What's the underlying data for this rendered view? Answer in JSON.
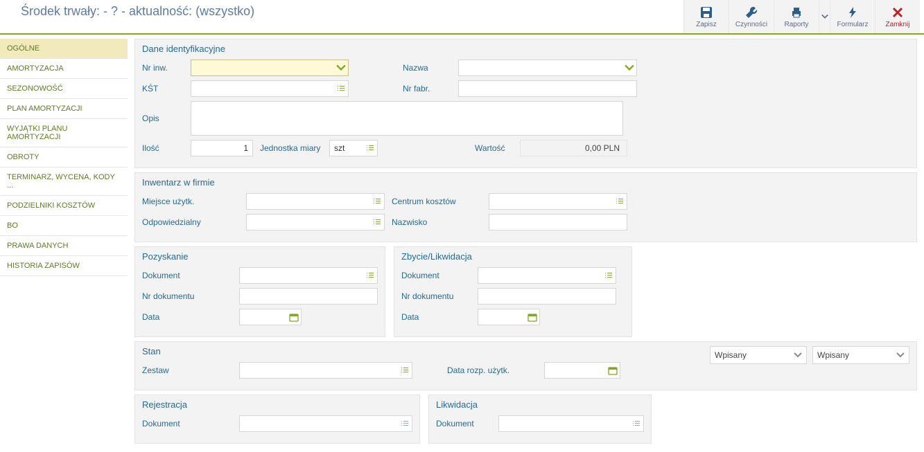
{
  "header": {
    "title": "Środek trwały: - ? - aktualność: (wszystko)",
    "toolbar": {
      "save": "Zapisz",
      "actions": "Czynności",
      "reports": "Raporty",
      "form": "Formularz",
      "close": "Zamknij"
    }
  },
  "sidebar": {
    "items": [
      {
        "label": "OGÓLNE",
        "active": true
      },
      {
        "label": "AMORTYZACJA"
      },
      {
        "label": "SEZONOWOŚĆ"
      },
      {
        "label": "PLAN AMORTYZACJI"
      },
      {
        "label": "WYJĄTKI PLANU AMORTYZACJI"
      },
      {
        "label": "OBROTY"
      },
      {
        "label": "TERMINARZ, WYCENA, KODY ..."
      },
      {
        "label": "PODZIELNIKI KOSZTÓW"
      },
      {
        "label": "BO"
      },
      {
        "label": "PRAWA DANYCH"
      },
      {
        "label": "HISTORIA ZAPISÓW"
      }
    ]
  },
  "sections": {
    "ident": {
      "title": "Dane identyfikacyjne",
      "nr_inw_label": "Nr inw.",
      "nr_inw_value": "",
      "nazwa_label": "Nazwa",
      "nazwa_value": "",
      "kst_label": "KŚT",
      "kst_value": "",
      "nr_fabr_label": "Nr fabr.",
      "nr_fabr_value": "",
      "opis_label": "Opis",
      "opis_value": "",
      "ilosc_label": "Ilość",
      "ilosc_value": "1",
      "jm_label": "Jednostka miary",
      "jm_value": "szt",
      "wartosc_label": "Wartość",
      "wartosc_value": "0,00 PLN"
    },
    "inwentarz": {
      "title": "Inwentarz w firmie",
      "miejsce_label": "Miejsce użytk.",
      "centrum_label": "Centrum kosztów",
      "odp_label": "Odpowiedzialny",
      "nazwisko_label": "Nazwisko"
    },
    "pozyskanie": {
      "title": "Pozyskanie",
      "dok_label": "Dokument",
      "nrdok_label": "Nr dokumentu",
      "data_label": "Data"
    },
    "zbycie": {
      "title": "Zbycie/Likwidacja",
      "dok_label": "Dokument",
      "nrdok_label": "Nr dokumentu",
      "data_label": "Data"
    },
    "stan": {
      "title": "Stan",
      "zestaw_label": "Zestaw",
      "data_rozp_label": "Data rozp. użytk.",
      "select1": "Wpisany",
      "select2": "Wpisany"
    },
    "rejestracja": {
      "title": "Rejestracja",
      "dok_label": "Dokument"
    },
    "likwidacja": {
      "title": "Likwidacja",
      "dok_label": "Dokument"
    }
  }
}
